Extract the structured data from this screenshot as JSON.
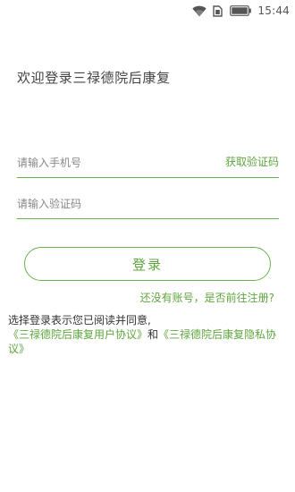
{
  "status_bar": {
    "icons": [
      "wifi-icon",
      "sim-icon",
      "battery-icon"
    ],
    "time": "15:44"
  },
  "welcome_text": "欢迎登录三禄德院后康复",
  "phone_field": {
    "placeholder": "请输入手机号",
    "value": ""
  },
  "get_code_label": "获取验证码",
  "code_field": {
    "placeholder": "请输入验证码",
    "value": ""
  },
  "login_button_label": "登录",
  "register_prompt": "还没有账号，是否前往注册?",
  "agreement": {
    "prefix": "选择登录表示您已阅读并同意,",
    "user_agreement": "《三禄德院后康复用户协议》",
    "conjunction": "和",
    "privacy_agreement": "《三禄德院后康复隐私协议》"
  },
  "colors": {
    "accent": "#5fa53e",
    "accent_line": "#6ab14e",
    "text": "#333333",
    "placeholder": "#888888",
    "background": "#ffffff"
  }
}
